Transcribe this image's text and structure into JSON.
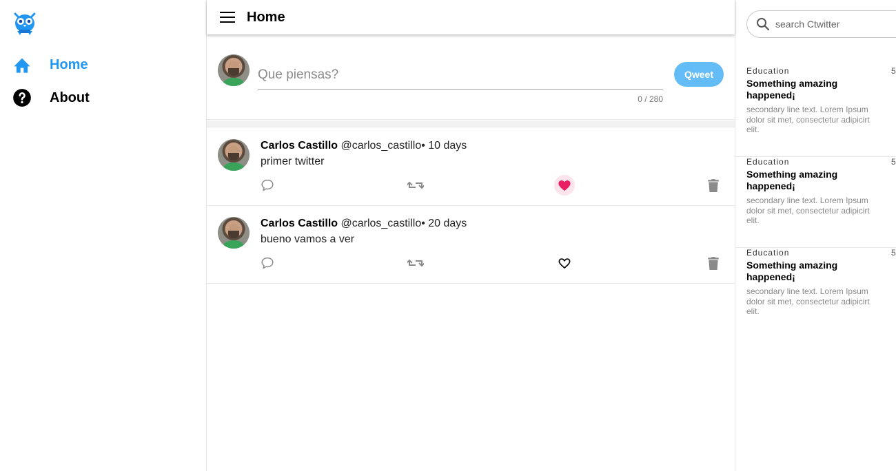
{
  "nav": {
    "items": [
      {
        "label": "Home",
        "icon": "home-icon",
        "active": true
      },
      {
        "label": "About",
        "icon": "help-circle-icon",
        "active": false
      }
    ],
    "accent_color": "#2196f3"
  },
  "header": {
    "title": "Home"
  },
  "composer": {
    "placeholder": "Que piensas?",
    "char_count": "0 / 280",
    "submit_label": "Qweet",
    "submit_color": "#64bcf6"
  },
  "tweets": [
    {
      "name": "Carlos Castillo",
      "handle": "@carlos_castillo",
      "time": "• 10 days",
      "text": "primer twitter",
      "liked": true
    },
    {
      "name": "Carlos Castillo",
      "handle": "@carlos_castillo",
      "time": "• 20 days",
      "text": "bueno vamos a ver",
      "liked": false
    }
  ],
  "like_color": "#e91e63",
  "search": {
    "placeholder": "search Ctwitter"
  },
  "trends": [
    {
      "category": "Education",
      "count": "5",
      "title": "Something amazing happened¡",
      "description": "secondary line text. Lorem Ipsum dolor sit met, consectetur adipicirt elit."
    },
    {
      "category": "Education",
      "count": "5",
      "title": "Something amazing happened¡",
      "description": "secondary line text. Lorem Ipsum dolor sit met, consectetur adipicirt elit."
    },
    {
      "category": "Education",
      "count": "5",
      "title": "Something amazing happened¡",
      "description": "secondary line text. Lorem Ipsum dolor sit met, consectetur adipicirt elit."
    }
  ]
}
